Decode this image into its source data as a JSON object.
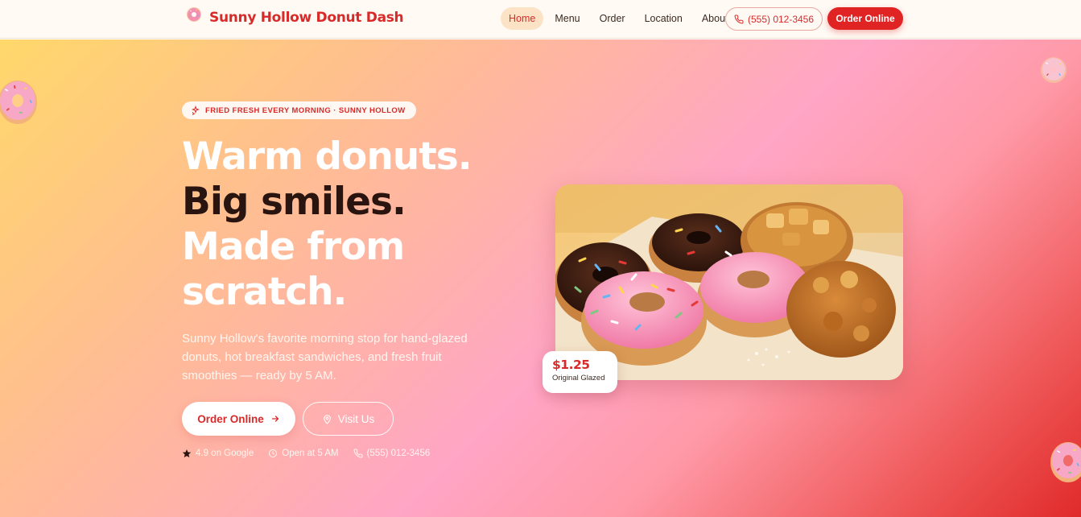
{
  "brand": {
    "name": "Sunny Hollow Donut Dash",
    "logo_icon": "donut-icon"
  },
  "nav": {
    "links": [
      {
        "label": "Home",
        "active": true
      },
      {
        "label": "Menu",
        "active": false
      },
      {
        "label": "Order",
        "active": false
      },
      {
        "label": "Location",
        "active": false
      },
      {
        "label": "About",
        "active": false
      }
    ],
    "phone": "(555) 012-3456",
    "order_label": "Order Online"
  },
  "hero": {
    "badge": "FRIED FRESH EVERY MORNING · SUNNY HOLLOW",
    "headline_line1": "Warm donuts.",
    "headline_line2": "Big smiles.",
    "headline_line3": "Made from scratch.",
    "subcopy": "Sunny Hollow's favorite morning stop for hand-glazed donuts, hot breakfast sandwiches, and fresh fruit smoothies — ready by 5 AM.",
    "primary_button": "Order Online",
    "secondary_button": "Visit Us",
    "stats": [
      {
        "icon": "star-icon",
        "text": "4.9 on Google"
      },
      {
        "icon": "clock-icon",
        "text": "Open at 5 AM"
      },
      {
        "icon": "phone-icon",
        "text": "(555) 012-3456"
      }
    ],
    "price_tag": {
      "price": "$1.25",
      "label": "Original Glazed"
    }
  },
  "colors": {
    "brand_red": "#d92a2a",
    "button_red": "#e02424",
    "dark_text": "#2a1410",
    "gradient": [
      "#ffd86b",
      "#ffa5c5",
      "#e02a2a"
    ]
  }
}
